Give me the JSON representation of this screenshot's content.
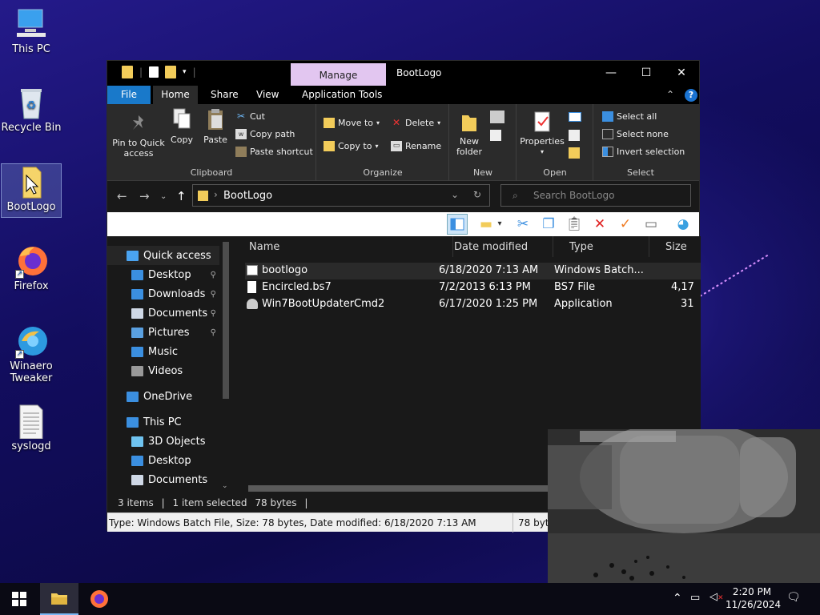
{
  "desktop": {
    "icons": [
      {
        "label": "This PC"
      },
      {
        "label": "Recycle Bin"
      },
      {
        "label": "BootLogo"
      },
      {
        "label": "Firefox"
      },
      {
        "label": "Winaero Tweaker"
      },
      {
        "label": "syslogd"
      }
    ]
  },
  "window": {
    "title": "BootLogo",
    "context_tab": "Manage",
    "controls": {
      "minimize": "—",
      "maximize": "☐",
      "close": "✕"
    },
    "tabs": [
      "File",
      "Home",
      "Share",
      "View",
      "Application Tools"
    ],
    "help": "?",
    "ribbon": {
      "clipboard": {
        "label": "Clipboard",
        "pin": "Pin to Quick access",
        "copy": "Copy",
        "paste": "Paste",
        "cut": "Cut",
        "copy_path": "Copy path",
        "paste_shortcut": "Paste shortcut"
      },
      "organize": {
        "label": "Organize",
        "move_to": "Move to",
        "copy_to": "Copy to",
        "delete": "Delete",
        "rename": "Rename"
      },
      "new": {
        "label": "New",
        "new_folder": "New folder"
      },
      "open": {
        "label": "Open",
        "properties": "Properties"
      },
      "select": {
        "label": "Select",
        "select_all": "Select all",
        "select_none": "Select none",
        "invert": "Invert selection"
      }
    },
    "address": {
      "path": "BootLogo"
    },
    "search": {
      "placeholder": "Search BootLogo"
    },
    "nav_pane": [
      {
        "label": "Quick access",
        "icon": "star-icon",
        "color": "#4aa3f0",
        "pinned": false
      },
      {
        "label": "Desktop",
        "icon": "desktop-icon",
        "color": "#3b8fe0",
        "pinned": true
      },
      {
        "label": "Downloads",
        "icon": "download-icon",
        "color": "#3b8fe0",
        "pinned": true
      },
      {
        "label": "Documents",
        "icon": "document-icon",
        "color": "#cfd8e6",
        "pinned": true
      },
      {
        "label": "Pictures",
        "icon": "pictures-icon",
        "color": "#5aa0e0",
        "pinned": true
      },
      {
        "label": "Music",
        "icon": "music-icon",
        "color": "#3b8fe0",
        "pinned": false
      },
      {
        "label": "Videos",
        "icon": "videos-icon",
        "color": "#999999",
        "pinned": false
      },
      {
        "label": "OneDrive",
        "icon": "cloud-icon",
        "color": "#3b8fe0",
        "pinned": false
      },
      {
        "label": "This PC",
        "icon": "computer-icon",
        "color": "#3b8fe0",
        "pinned": false
      },
      {
        "label": "3D Objects",
        "icon": "cube-icon",
        "color": "#6fc3f0",
        "pinned": false
      },
      {
        "label": "Desktop",
        "icon": "desktop-icon",
        "color": "#3b8fe0",
        "pinned": false
      },
      {
        "label": "Documents",
        "icon": "document-icon",
        "color": "#cfd8e6",
        "pinned": false
      }
    ],
    "columns": [
      "Name",
      "Date modified",
      "Type",
      "Size"
    ],
    "files": [
      {
        "name": "bootlogo",
        "date": "6/18/2020 7:13 AM",
        "type": "Windows Batch...",
        "size": "",
        "icon": "batch-file-icon",
        "selected": true
      },
      {
        "name": "Encircled.bs7",
        "date": "7/2/2013 6:13 PM",
        "type": "BS7 File",
        "size": "4,17",
        "icon": "file-icon",
        "selected": false
      },
      {
        "name": "Win7BootUpdaterCmd2",
        "date": "6/17/2020 1:25 PM",
        "type": "Application",
        "size": "31",
        "icon": "app-icon",
        "selected": false
      }
    ],
    "status": {
      "count": "3 items",
      "selected": "1 item selected",
      "size": "78 bytes"
    },
    "statusbar": {
      "text": "Type: Windows Batch File, Size: 78 bytes, Date modified: 6/18/2020 7:13 AM",
      "size": "78 bytes"
    }
  },
  "taskbar": {
    "time": "2:20 PM",
    "date": "11/26/2024"
  }
}
